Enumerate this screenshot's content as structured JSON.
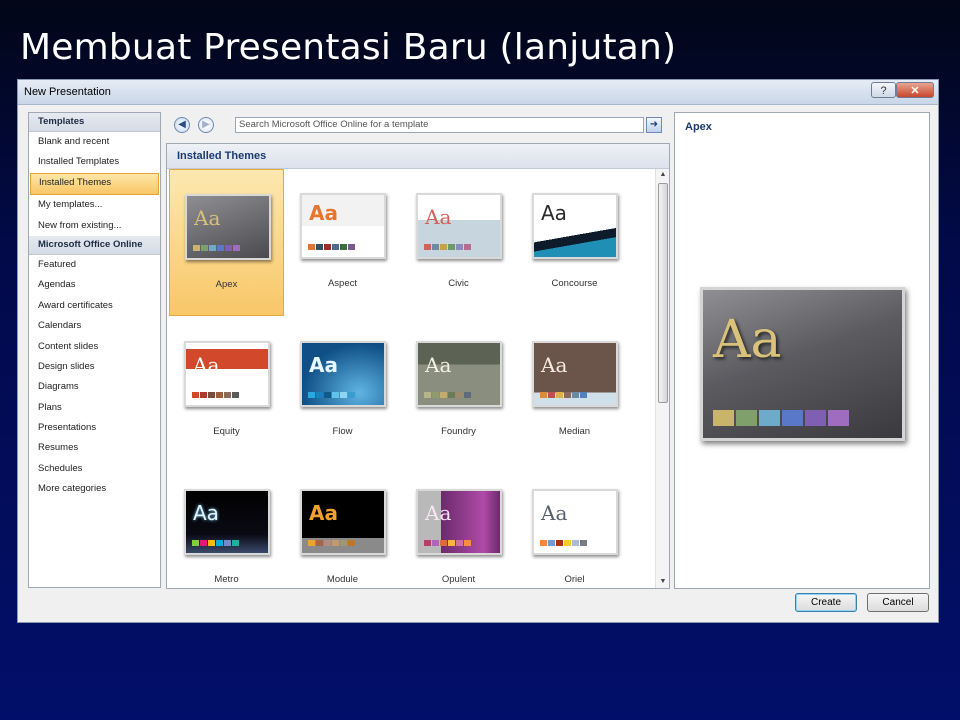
{
  "slide": {
    "title": "Membuat Presentasi Baru (lanjutan)"
  },
  "dialog": {
    "title": "New Presentation",
    "help_label": "?",
    "close_label": "✕",
    "left_nav": {
      "section1": "Templates",
      "items1": [
        "Blank and recent",
        "Installed Templates",
        "Installed Themes",
        "My templates...",
        "New from existing..."
      ],
      "selected": "Installed Themes",
      "section2": "Microsoft Office Online",
      "items2": [
        "Featured",
        "Agendas",
        "Award certificates",
        "Calendars",
        "Content slides",
        "Design slides",
        "Diagrams",
        "Plans",
        "Presentations",
        "Resumes",
        "Schedules",
        "More categories"
      ]
    },
    "search": {
      "placeholder": "Search Microsoft Office Online for a template",
      "back_icon": "back-arrow-icon",
      "forward_icon": "forward-arrow-icon",
      "go_icon": "go-arrow-icon"
    },
    "center_header": "Installed Themes",
    "themes": [
      {
        "name": "Apex",
        "selected": true
      },
      {
        "name": "Aspect"
      },
      {
        "name": "Civic"
      },
      {
        "name": "Concourse"
      },
      {
        "name": "Equity"
      },
      {
        "name": "Flow"
      },
      {
        "name": "Foundry"
      },
      {
        "name": "Median"
      },
      {
        "name": "Metro"
      },
      {
        "name": "Module"
      },
      {
        "name": "Opulent"
      },
      {
        "name": "Oriel"
      }
    ],
    "preview": {
      "title": "Apex",
      "sample_text": "Aa"
    },
    "buttons": {
      "create": "Create",
      "cancel": "Cancel"
    }
  },
  "colors": {
    "selection": "#f9c564",
    "header_text": "#1b3a70",
    "slide_bg": "#020a4a"
  }
}
